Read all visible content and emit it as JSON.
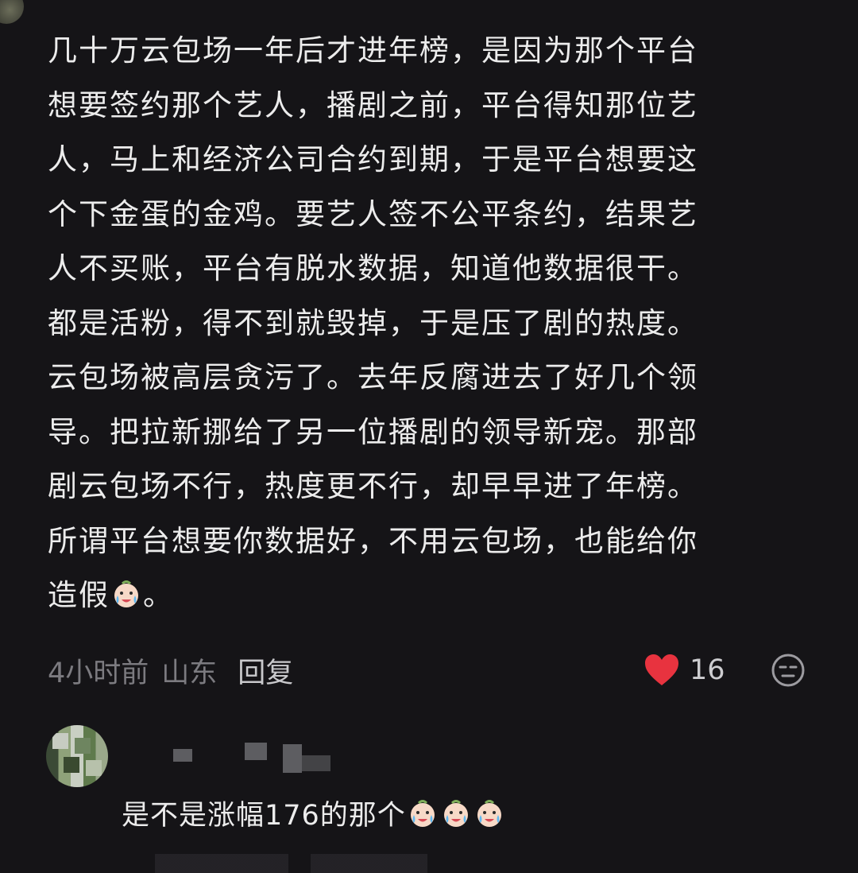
{
  "comment": {
    "lines": [
      "几十万云包场一年后才进年榜，是因为那个平台",
      "想要签约那个艺人，播剧之前，平台得知那位艺",
      "人，马上和经济公司合约到期，于是平台想要这",
      "个下金蛋的金鸡。要艺人签不公平条约，结果艺",
      "人不买账，平台有脱水数据，知道他数据很干。",
      "都是活粉，得不到就毁掉，于是压了剧的热度。",
      "云包场被高层贪污了。去年反腐进去了好几个领",
      "导。把拉新挪给了另一位播剧的领导新宠。那部",
      "剧云包场不行，热度更不行，却早早进了年榜。",
      "所谓平台想要你数据好，不用云包场，也能给你"
    ],
    "last_line_text": "造假",
    "last_line_end": "。",
    "emoji_icon": "crying-face-emoji"
  },
  "meta": {
    "time": "4小时前",
    "location": "山东",
    "reply_label": "回复",
    "like_count": "16",
    "like_icon": "heart-icon",
    "like_color": "#e8333f",
    "dislike_icon": "dislike-face-icon"
  },
  "reply": {
    "text": "是不是涨幅176的那个",
    "emoji_icon": "crying-face-emoji",
    "emoji_count": 3
  }
}
